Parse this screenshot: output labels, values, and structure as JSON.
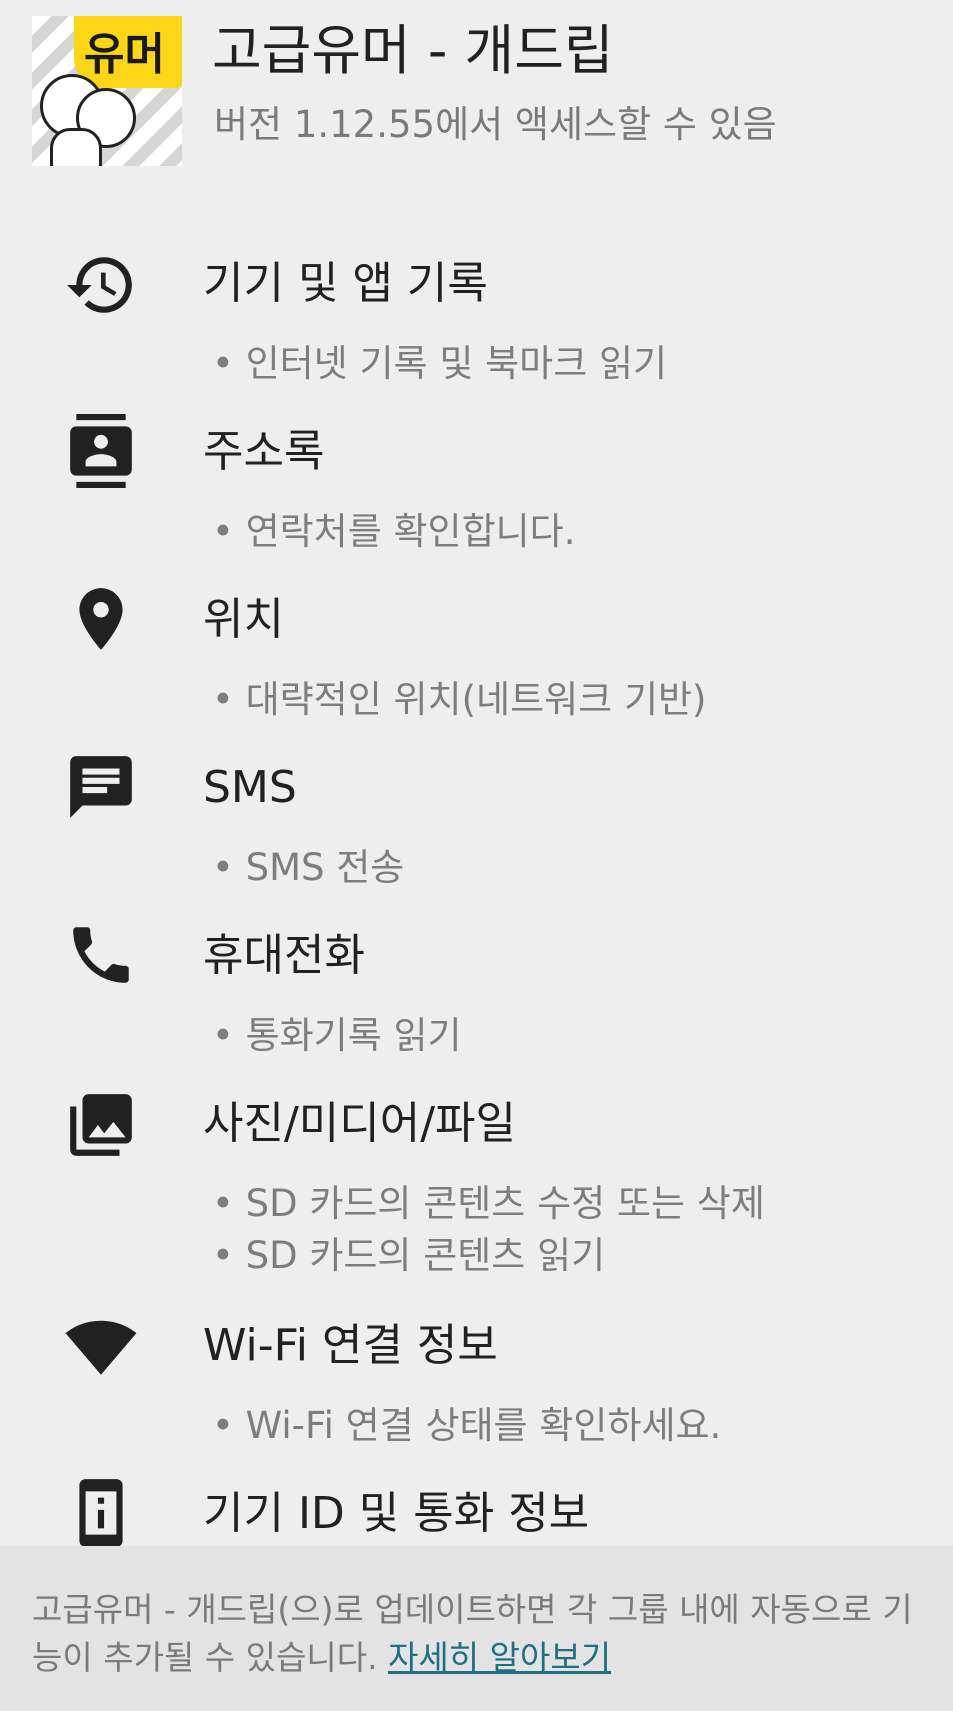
{
  "app": {
    "icon_text": "유머",
    "title": "고급유머 - 개드립",
    "version_text": "버전 1.12.55에서 액세스할 수 있음"
  },
  "permissions": [
    {
      "icon": "history-icon",
      "title": "기기 및 앱 기록",
      "details": [
        "인터넷 기록 및 북마크 읽기"
      ]
    },
    {
      "icon": "contacts-icon",
      "title": "주소록",
      "details": [
        "연락처를 확인합니다."
      ]
    },
    {
      "icon": "location-pin-icon",
      "title": "위치",
      "details": [
        "대략적인 위치(네트워크 기반)"
      ]
    },
    {
      "icon": "message-icon",
      "title": "SMS",
      "details": [
        "SMS 전송"
      ]
    },
    {
      "icon": "phone-icon",
      "title": "휴대전화",
      "details": [
        "통화기록 읽기"
      ]
    },
    {
      "icon": "photo-library-icon",
      "title": "사진/미디어/파일",
      "details": [
        "SD 카드의 콘텐츠 수정 또는 삭제",
        "SD 카드의 콘텐츠 읽기"
      ]
    },
    {
      "icon": "wifi-icon",
      "title": "Wi-Fi 연결 정보",
      "details": [
        "Wi-Fi 연결 상태를 확인하세요."
      ]
    },
    {
      "icon": "device-info-icon",
      "title": "기기 ID 및 통화 정보",
      "details": []
    }
  ],
  "footer": {
    "text": "고급유머 - 개드립(으)로 업데이트하면 각 그룹 내에 자동으로 기능이 추가될 수 있습니다. ",
    "link_label": "자세히 알아보기"
  }
}
